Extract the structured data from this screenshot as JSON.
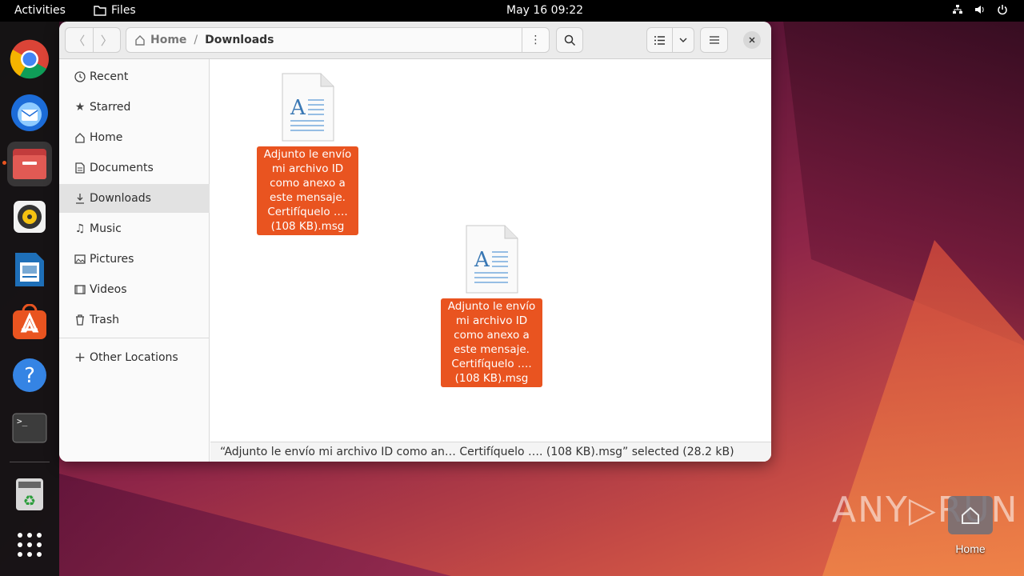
{
  "topbar": {
    "activities": "Activities",
    "app_name": "Files",
    "clock": "May 16  09:22"
  },
  "dock": {
    "apps": [
      "chrome-icon",
      "thunderbird-icon",
      "files-icon",
      "rhythmbox-icon",
      "libreoffice-writer-icon",
      "app-center-icon",
      "help-icon",
      "terminal-icon",
      "trash-icon",
      "show-apps-icon"
    ]
  },
  "window": {
    "path": {
      "home": "Home",
      "separator": "/",
      "current": "Downloads"
    },
    "sidebar": {
      "items": [
        {
          "label": "Recent",
          "icon": "clock-icon"
        },
        {
          "label": "Starred",
          "icon": "star-icon"
        },
        {
          "label": "Home",
          "icon": "home-icon"
        },
        {
          "label": "Documents",
          "icon": "document-icon"
        },
        {
          "label": "Downloads",
          "icon": "download-icon"
        },
        {
          "label": "Music",
          "icon": "music-icon"
        },
        {
          "label": "Pictures",
          "icon": "picture-icon"
        },
        {
          "label": "Videos",
          "icon": "video-icon"
        },
        {
          "label": "Trash",
          "icon": "trash-icon"
        }
      ],
      "other_locations": "Other Locations"
    },
    "files": [
      {
        "name": "Adjunto le envío mi archivo ID como anexo a este mensaje. Certifíquelo …. (108 KB).msg"
      },
      {
        "name": "Adjunto le envío mi archivo ID como anexo a este mensaje. Certifíquelo …. (108 KB).msg"
      }
    ],
    "status": "“Adjunto le envío mi archivo ID como an… Certifíquelo …. (108 KB).msg” selected (28.2 kB)"
  },
  "desktop": {
    "watermark": "ANY▷RUN",
    "home_icon_label": "Home"
  },
  "colors": {
    "accent": "#e95420",
    "selected_sidebar": "#e2e2e2"
  }
}
